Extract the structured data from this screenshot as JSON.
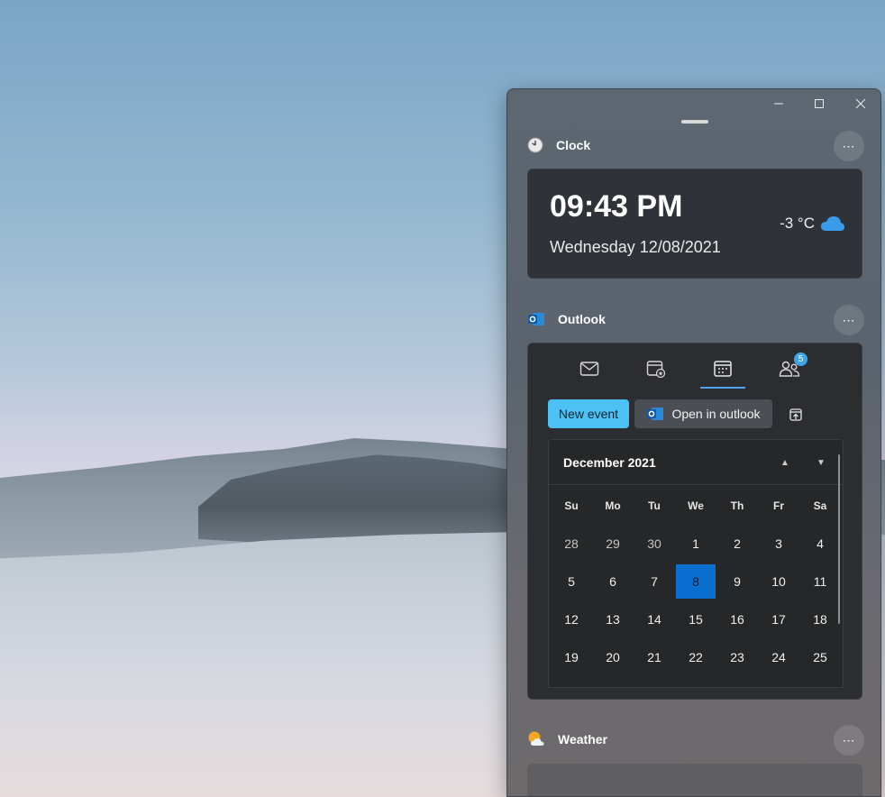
{
  "window": {
    "minimize_icon": "minimize-icon",
    "maximize_icon": "maximize-icon",
    "close_icon": "close-icon"
  },
  "clock": {
    "title": "Clock",
    "more": "⋯",
    "time": "09:43 PM",
    "date": "Wednesday 12/08/2021",
    "temperature": "-3 °C",
    "weather_icon": "cloud-icon"
  },
  "outlook": {
    "title": "Outlook",
    "more": "⋯",
    "tabs": [
      {
        "name": "mail",
        "icon": "mail-icon"
      },
      {
        "name": "starred-events",
        "icon": "calendar-star-icon"
      },
      {
        "name": "calendar",
        "icon": "calendar-icon",
        "active": true
      },
      {
        "name": "people",
        "icon": "people-icon",
        "badge": "5"
      }
    ],
    "new_event_label": "New event",
    "open_in_outlook_label": "Open in outlook",
    "accent_color": "#4dc1f3",
    "calendar": {
      "month_label": "December 2021",
      "weekdays": [
        "Su",
        "Mo",
        "Tu",
        "We",
        "Th",
        "Fr",
        "Sa"
      ],
      "weeks": [
        [
          "28",
          "29",
          "30",
          "1",
          "2",
          "3",
          "4"
        ],
        [
          "5",
          "6",
          "7",
          "8",
          "9",
          "10",
          "11"
        ],
        [
          "12",
          "13",
          "14",
          "15",
          "16",
          "17",
          "18"
        ],
        [
          "19",
          "20",
          "21",
          "22",
          "23",
          "24",
          "25"
        ]
      ],
      "selected_day": "8",
      "selected_color": "#0a6fcf"
    }
  },
  "weather": {
    "title": "Weather",
    "more": "⋯"
  }
}
